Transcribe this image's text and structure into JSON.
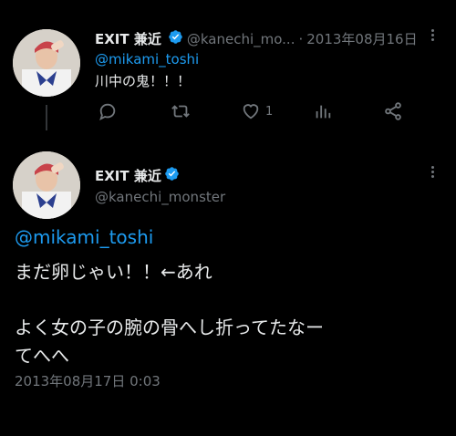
{
  "reply_tweet": {
    "display_name": "EXIT 兼近",
    "handle": "@kanechi_mo...",
    "separator": "·",
    "date": "2013年08月16日",
    "mention": "@mikami_toshi",
    "text": "川中の鬼！！！",
    "actions": {
      "reply_icon": "reply-icon",
      "retweet_icon": "retweet-icon",
      "like_icon": "heart-icon",
      "like_count": "1",
      "views_icon": "views-icon",
      "share_icon": "share-icon"
    }
  },
  "main_tweet": {
    "display_name": "EXIT 兼近",
    "handle": "@kanechi_monster",
    "mention": "@mikami_toshi",
    "line1": "まだ卵じゃい！！←あれ",
    "line2": "よく女の子の腕の骨へし折ってたなー",
    "line3": "てへへ",
    "timestamp": "2013年08月17日 0:03"
  },
  "colors": {
    "background": "#000000",
    "text": "#e7e9ea",
    "muted": "#71767b",
    "link": "#1d9bf0",
    "verified": "#1d9bf0"
  }
}
